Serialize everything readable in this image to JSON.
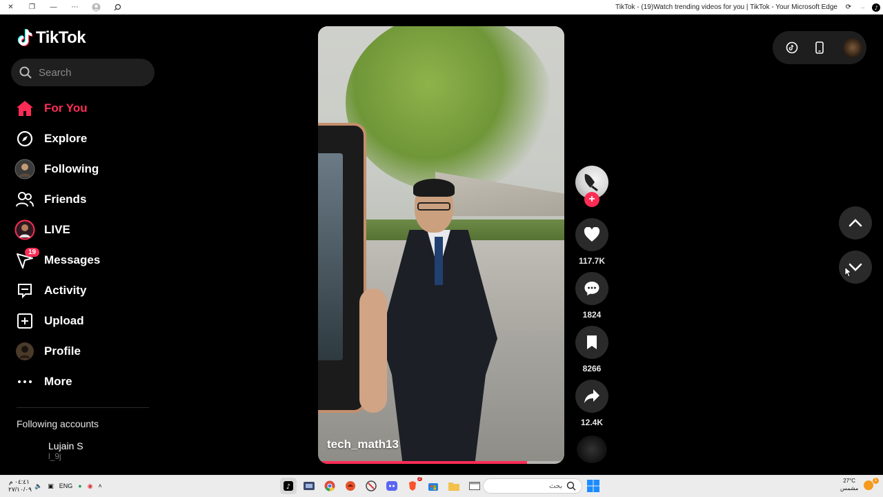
{
  "window": {
    "title": "TikTok - (19)Watch trending videos for you | TikTok - Your Microsoft Edge"
  },
  "sidebar": {
    "logo": "TikTok",
    "search_placeholder": "Search",
    "items": [
      {
        "label": "For You",
        "icon": "home-icon",
        "active": true
      },
      {
        "label": "Explore",
        "icon": "compass-icon"
      },
      {
        "label": "Following",
        "icon": "following-avatar-icon"
      },
      {
        "label": "Friends",
        "icon": "friends-icon"
      },
      {
        "label": "LIVE",
        "icon": "live-avatar-icon"
      },
      {
        "label": "Messages",
        "icon": "messages-icon",
        "badge": "19"
      },
      {
        "label": "Activity",
        "icon": "activity-icon"
      },
      {
        "label": "Upload",
        "icon": "upload-icon"
      },
      {
        "label": "Profile",
        "icon": "profile-avatar-icon"
      },
      {
        "label": "More",
        "icon": "more-icon"
      }
    ],
    "following_title": "Following accounts",
    "following_accounts": [
      {
        "name": "Lujain S",
        "handle": "l_9j"
      }
    ]
  },
  "video": {
    "author": "tech_math13",
    "progress": 0.85
  },
  "actions": {
    "likes": "117.7K",
    "comments": "1824",
    "bookmarks": "8266",
    "shares": "12.4K"
  },
  "taskbar": {
    "time": "٠٤:٤١ م",
    "date": "٢٧/١٠/٠٩",
    "language": "ENG",
    "search_placeholder": "بحث",
    "temperature": "27°C",
    "weather": "مشمس",
    "notification_count": "1",
    "brave_badge": "2"
  },
  "colors": {
    "accent": "#fe2c55",
    "background": "#000000"
  }
}
